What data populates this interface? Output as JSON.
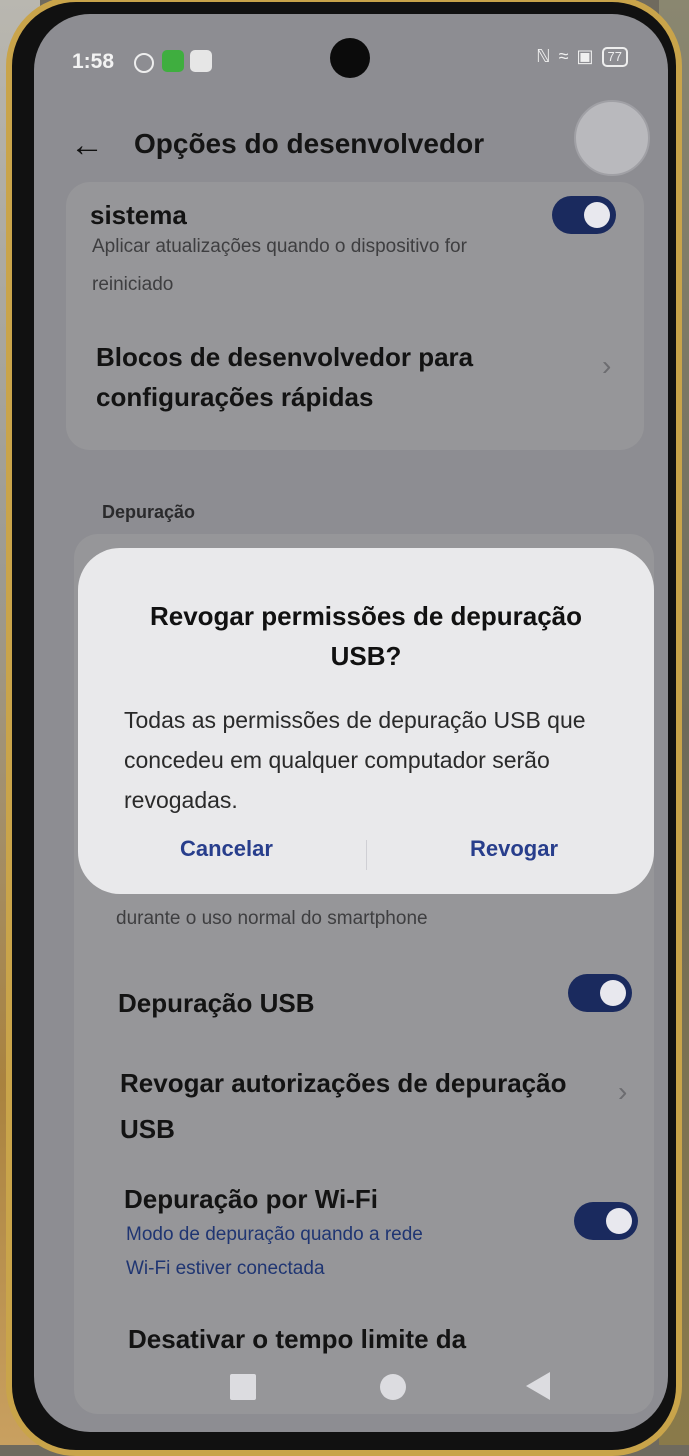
{
  "status_bar": {
    "time": "1:58",
    "battery": "77"
  },
  "header": {
    "title": "Opções do desenvolvedor"
  },
  "items": {
    "system_updates": {
      "title": "sistema",
      "subtitle_line1": "Aplicar atualizações quando o dispositivo for",
      "subtitle_line2": "reiniciado",
      "enabled": true
    },
    "dev_tiles": {
      "title_line1": "Blocos de desenvolvedor para",
      "title_line2": "configurações rápidas"
    },
    "section_debug": "Depuração",
    "hidden_partial": "durante o uso normal do smartphone",
    "usb_debug": {
      "title": "Depuração USB",
      "enabled": true
    },
    "revoke_usb": {
      "title_line1": "Revogar autorizações de depuração",
      "title_line2": "USB"
    },
    "wifi_debug": {
      "title": "Depuração por Wi-Fi",
      "subtitle_line1": "Modo de depuração quando a rede",
      "subtitle_line2": "Wi-Fi estiver conectada",
      "enabled": true
    },
    "timeout": {
      "title": "Desativar o tempo limite da"
    }
  },
  "dialog": {
    "title": "Revogar permissões de depuração USB?",
    "body": "Todas as permissões de depuração USB que concedeu em qualquer computador serão revogadas.",
    "cancel_label": "Cancelar",
    "confirm_label": "Revogar"
  },
  "colors": {
    "accent": "#283e8c",
    "toggle_on": "#1a2a5e",
    "frame": "#c9a44a"
  }
}
